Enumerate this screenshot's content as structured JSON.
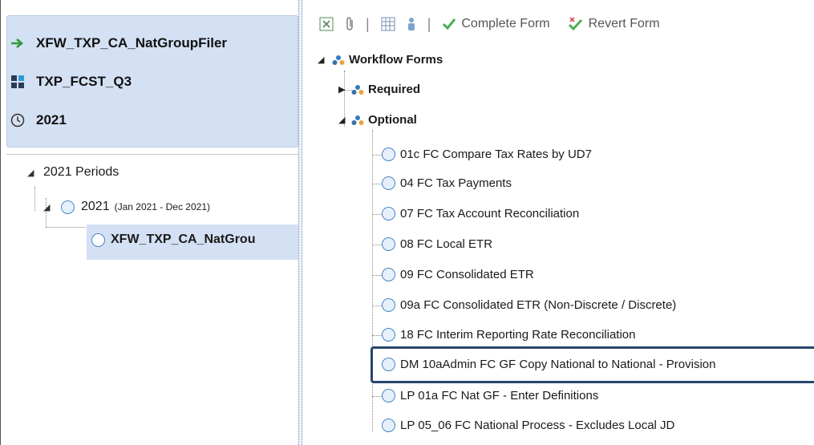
{
  "left_panel": {
    "workflow_name": "XFW_TXP_CA_NatGroupFiler",
    "scenario": "TXP_FCST_Q3",
    "time": "2021",
    "tree": {
      "root": "2021 Periods",
      "year_label": "2021",
      "year_range": "(Jan 2021 - Dec 2021)",
      "selected_item": "XFW_TXP_CA_NatGrou"
    }
  },
  "toolbar": {
    "complete_form": "Complete Form",
    "revert_form": "Revert Form"
  },
  "forms_tree": {
    "root": "Workflow Forms",
    "required": "Required",
    "optional": "Optional",
    "items": [
      "01c FC Compare Tax Rates by UD7",
      "04 FC Tax Payments",
      "07 FC Tax Account Reconciliation",
      "08 FC Local ETR",
      "09 FC Consolidated ETR",
      "09a FC Consolidated ETR (Non-Discrete / Discrete)",
      "18 FC Interim Reporting Rate Reconciliation",
      "DM 10aAdmin FC GF Copy National to National - Provision",
      "LP 01a FC Nat GF - Enter Definitions",
      "LP 05_06 FC National Process - Excludes Local JD"
    ]
  },
  "colors": {
    "info_bg": "#d4e0f3",
    "arrow_green": "#2e9b3a",
    "highlight_border": "#27466e",
    "circle_blue": "#4b86c2"
  }
}
